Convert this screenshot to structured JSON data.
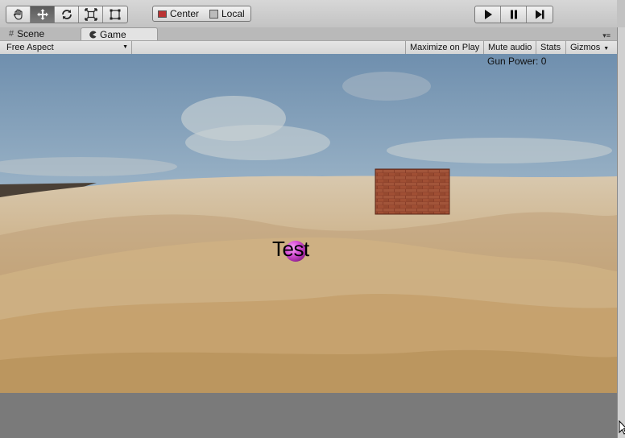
{
  "toolbar": {
    "tools": [
      {
        "name": "hand-tool",
        "icon": "hand-icon"
      },
      {
        "name": "move-tool",
        "icon": "move-arrows-icon"
      },
      {
        "name": "rotate-tool",
        "icon": "rotate-icon"
      },
      {
        "name": "scale-tool",
        "icon": "scale-icon"
      },
      {
        "name": "rect-tool",
        "icon": "rect-icon"
      }
    ],
    "pivot_label": "Center",
    "space_label": "Local",
    "play_icons": [
      "play-icon",
      "pause-icon",
      "step-icon"
    ]
  },
  "tabs": {
    "scene_label": "Scene",
    "game_label": "Game"
  },
  "game_bar": {
    "aspect_label": "Free Aspect",
    "maximize_label": "Maximize on Play",
    "mute_label": "Mute audio",
    "stats_label": "Stats",
    "gizmos_label": "Gizmos"
  },
  "game_view": {
    "hud_text": "Gun Power: 0",
    "world_label": "Test"
  },
  "colors": {
    "sky_top": "#7e98b4",
    "sand": "#c9b08a",
    "brick": "#8a3f2a",
    "sphere": "#d84fd8"
  }
}
